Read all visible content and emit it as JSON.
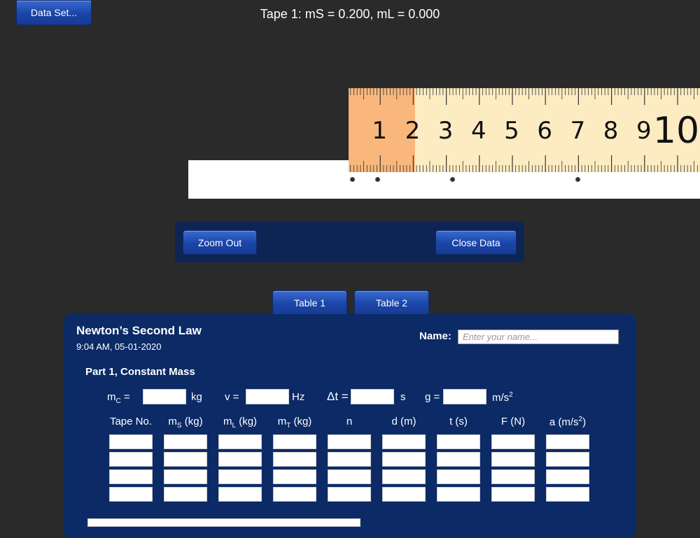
{
  "toolbar": {
    "dataset_label": "Data Set..."
  },
  "tape": {
    "title": "Tape 1: mS = 0.200, mL = 0.000"
  },
  "ruler": {
    "numbers": [
      "1",
      "2",
      "3",
      "4",
      "5",
      "6",
      "7",
      "8",
      "9",
      "10"
    ]
  },
  "controls": {
    "zoom_out_label": "Zoom Out",
    "close_data_label": "Close Data"
  },
  "tabs": [
    {
      "label": "Table 1"
    },
    {
      "label": "Table 2"
    }
  ],
  "panel": {
    "title": "Newton’s Second Law",
    "timestamp": "9:04 AM, 05-01-2020",
    "name_label": "Name:",
    "name_placeholder": "Enter your name...",
    "part_title": "Part 1, Constant Mass",
    "params": [
      {
        "symbol": "m",
        "sub": "C",
        "eq": " =",
        "unit": "kg"
      },
      {
        "symbol": "v =",
        "unit": "Hz"
      },
      {
        "symbol": "Δt =",
        "unit": "s"
      },
      {
        "symbol": "g =",
        "unit": "m/s",
        "unit_sup": "2"
      }
    ],
    "columns": [
      {
        "label": "Tape No."
      },
      {
        "label": "m",
        "sub": "S",
        "suffix": " (kg)"
      },
      {
        "label": "m",
        "sub": "L",
        "suffix": " (kg)"
      },
      {
        "label": "m",
        "sub": "T",
        "suffix": " (kg)"
      },
      {
        "label": "n"
      },
      {
        "label": "d (m)"
      },
      {
        "label": "t (s)"
      },
      {
        "label": "F (N)"
      },
      {
        "label": "a (m/s",
        "sup": "2",
        "suffix": ")"
      }
    ],
    "row_count": 4
  },
  "colors": {
    "background": "#2a2a2a",
    "panel": "#0b2a66",
    "controls": "#0e2454",
    "button": "#1a45a8",
    "tape_yellow": "#fdecc2",
    "tape_orange": "#f9b77c"
  }
}
